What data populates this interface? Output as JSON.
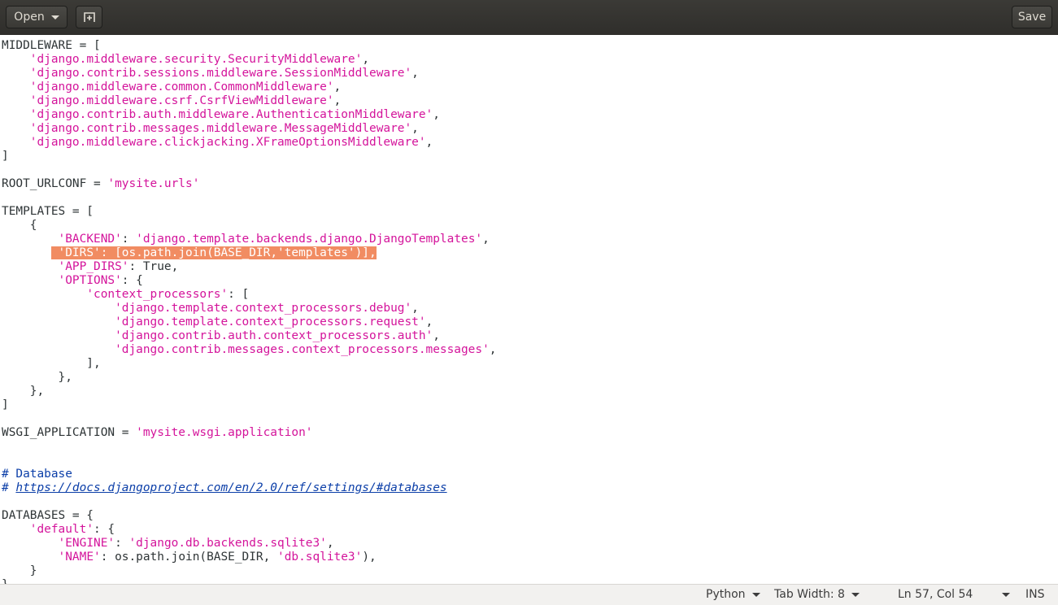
{
  "toolbar": {
    "open_label": "Open",
    "new_tab_icon": "new-tab-icon",
    "save_label": "Save"
  },
  "editor": {
    "lines": [
      [
        {
          "t": "MIDDLEWARE = [",
          "c": "k"
        }
      ],
      [
        {
          "t": "    ",
          "c": "k"
        },
        {
          "t": "'django.middleware.security.SecurityMiddleware'",
          "c": "s"
        },
        {
          "t": ",",
          "c": "k"
        }
      ],
      [
        {
          "t": "    ",
          "c": "k"
        },
        {
          "t": "'django.contrib.sessions.middleware.SessionMiddleware'",
          "c": "s"
        },
        {
          "t": ",",
          "c": "k"
        }
      ],
      [
        {
          "t": "    ",
          "c": "k"
        },
        {
          "t": "'django.middleware.common.CommonMiddleware'",
          "c": "s"
        },
        {
          "t": ",",
          "c": "k"
        }
      ],
      [
        {
          "t": "    ",
          "c": "k"
        },
        {
          "t": "'django.middleware.csrf.CsrfViewMiddleware'",
          "c": "s"
        },
        {
          "t": ",",
          "c": "k"
        }
      ],
      [
        {
          "t": "    ",
          "c": "k"
        },
        {
          "t": "'django.contrib.auth.middleware.AuthenticationMiddleware'",
          "c": "s"
        },
        {
          "t": ",",
          "c": "k"
        }
      ],
      [
        {
          "t": "    ",
          "c": "k"
        },
        {
          "t": "'django.contrib.messages.middleware.MessageMiddleware'",
          "c": "s"
        },
        {
          "t": ",",
          "c": "k"
        }
      ],
      [
        {
          "t": "    ",
          "c": "k"
        },
        {
          "t": "'django.middleware.clickjacking.XFrameOptionsMiddleware'",
          "c": "s"
        },
        {
          "t": ",",
          "c": "k"
        }
      ],
      [
        {
          "t": "]",
          "c": "k"
        }
      ],
      [],
      [
        {
          "t": "ROOT_URLCONF = ",
          "c": "k"
        },
        {
          "t": "'mysite.urls'",
          "c": "s"
        }
      ],
      [],
      [
        {
          "t": "TEMPLATES = [",
          "c": "k"
        }
      ],
      [
        {
          "t": "    {",
          "c": "k"
        }
      ],
      [
        {
          "t": "        ",
          "c": "k"
        },
        {
          "t": "'BACKEND'",
          "c": "s"
        },
        {
          "t": ": ",
          "c": "k"
        },
        {
          "t": "'django.template.backends.django.DjangoTemplates'",
          "c": "s"
        },
        {
          "t": ",",
          "c": "k"
        }
      ],
      [
        {
          "t": "       ",
          "c": "k"
        },
        {
          "t": " 'DIRS': [os.path.join(BASE_DIR,'templates')],",
          "c": "sel"
        }
      ],
      [
        {
          "t": "        ",
          "c": "k"
        },
        {
          "t": "'APP_DIRS'",
          "c": "s"
        },
        {
          "t": ": True,",
          "c": "k"
        }
      ],
      [
        {
          "t": "        ",
          "c": "k"
        },
        {
          "t": "'OPTIONS'",
          "c": "s"
        },
        {
          "t": ": {",
          "c": "k"
        }
      ],
      [
        {
          "t": "            ",
          "c": "k"
        },
        {
          "t": "'context_processors'",
          "c": "s"
        },
        {
          "t": ": [",
          "c": "k"
        }
      ],
      [
        {
          "t": "                ",
          "c": "k"
        },
        {
          "t": "'django.template.context_processors.debug'",
          "c": "s"
        },
        {
          "t": ",",
          "c": "k"
        }
      ],
      [
        {
          "t": "                ",
          "c": "k"
        },
        {
          "t": "'django.template.context_processors.request'",
          "c": "s"
        },
        {
          "t": ",",
          "c": "k"
        }
      ],
      [
        {
          "t": "                ",
          "c": "k"
        },
        {
          "t": "'django.contrib.auth.context_processors.auth'",
          "c": "s"
        },
        {
          "t": ",",
          "c": "k"
        }
      ],
      [
        {
          "t": "                ",
          "c": "k"
        },
        {
          "t": "'django.contrib.messages.context_processors.messages'",
          "c": "s"
        },
        {
          "t": ",",
          "c": "k"
        }
      ],
      [
        {
          "t": "            ],",
          "c": "k"
        }
      ],
      [
        {
          "t": "        },",
          "c": "k"
        }
      ],
      [
        {
          "t": "    },",
          "c": "k"
        }
      ],
      [
        {
          "t": "]",
          "c": "k"
        }
      ],
      [],
      [
        {
          "t": "WSGI_APPLICATION = ",
          "c": "k"
        },
        {
          "t": "'mysite.wsgi.application'",
          "c": "s"
        }
      ],
      [],
      [],
      [
        {
          "t": "# Database",
          "c": "c"
        }
      ],
      [
        {
          "t": "# ",
          "c": "c"
        },
        {
          "t": "https://docs.djangoproject.com/en/2.0/ref/settings/#databases",
          "c": "u"
        }
      ],
      [],
      [
        {
          "t": "DATABASES = {",
          "c": "k"
        }
      ],
      [
        {
          "t": "    ",
          "c": "k"
        },
        {
          "t": "'default'",
          "c": "s"
        },
        {
          "t": ": {",
          "c": "k"
        }
      ],
      [
        {
          "t": "        ",
          "c": "k"
        },
        {
          "t": "'ENGINE'",
          "c": "s"
        },
        {
          "t": ": ",
          "c": "k"
        },
        {
          "t": "'django.db.backends.sqlite3'",
          "c": "s"
        },
        {
          "t": ",",
          "c": "k"
        }
      ],
      [
        {
          "t": "        ",
          "c": "k"
        },
        {
          "t": "'NAME'",
          "c": "s"
        },
        {
          "t": ": os.path.join(BASE_DIR, ",
          "c": "k"
        },
        {
          "t": "'db.sqlite3'",
          "c": "s"
        },
        {
          "t": "),",
          "c": "k"
        }
      ],
      [
        {
          "t": "    }",
          "c": "k"
        }
      ],
      [
        {
          "t": "}",
          "c": "k"
        }
      ]
    ]
  },
  "statusbar": {
    "language": "Python",
    "tab_width": "Tab Width: 8",
    "position": "Ln 57, Col 54",
    "mode": "INS"
  }
}
